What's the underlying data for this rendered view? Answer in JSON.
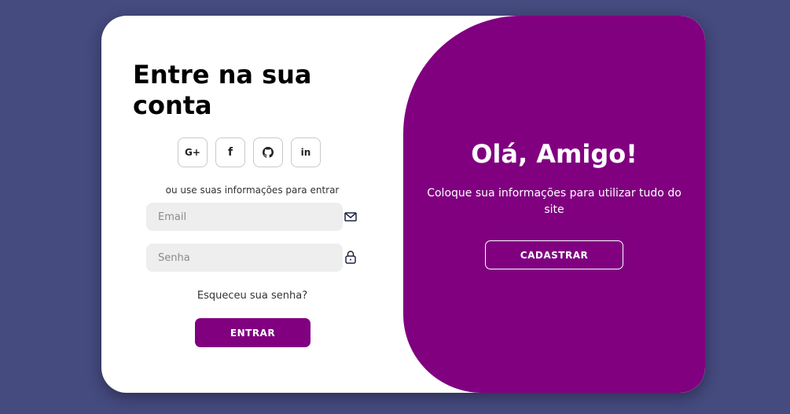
{
  "login": {
    "title": "Entre na sua conta",
    "alt_text": "ou use suas informações para entrar",
    "email_placeholder": "Email",
    "password_placeholder": "Senha",
    "forgot_text": "Esqueceu sua senha?",
    "submit_label": "ENTRAR",
    "socials": [
      {
        "label": "G+",
        "icon": "google-plus-icon"
      },
      {
        "label": "f",
        "icon": "facebook-icon"
      },
      {
        "label": "",
        "icon": "github-icon"
      },
      {
        "label": "in",
        "icon": "linkedin-icon"
      }
    ]
  },
  "panel": {
    "title": "Olá, Amigo!",
    "text": "Coloque sua informações para utilizar tudo do site",
    "button_label": "CADASTRAR"
  },
  "colors": {
    "background": "#454a7f",
    "accent": "#800080",
    "card": "#ffffff",
    "input": "#eeeeee"
  }
}
